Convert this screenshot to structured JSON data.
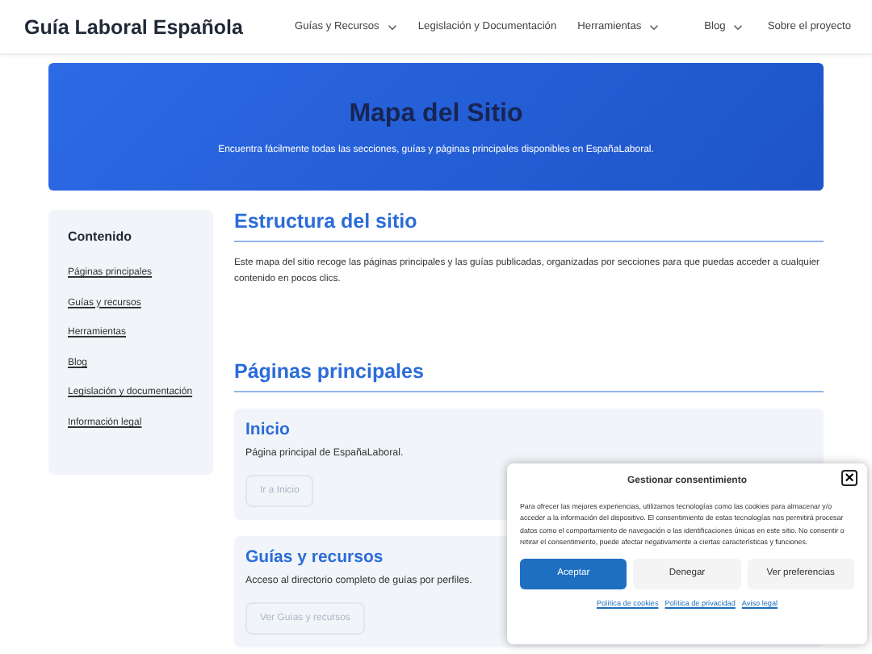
{
  "header": {
    "logo": "Guía Laboral Española",
    "nav": [
      {
        "label": "Guías y Recursos",
        "dropdown": true
      },
      {
        "label": "Legislación y Documentación",
        "dropdown": false
      },
      {
        "label": "Herramientas",
        "dropdown": true
      },
      {
        "label": "Blog",
        "dropdown": true
      },
      {
        "label": "Sobre el proyecto",
        "dropdown": false
      }
    ]
  },
  "hero": {
    "title": "Mapa del Sitio",
    "subtitle": "Encuentra fácilmente todas las secciones, guías y páginas principales disponibles en EspañaLaboral."
  },
  "sidebar": {
    "title": "Contenido",
    "links": [
      "Páginas principales",
      "Guías y recursos",
      "Herramientas",
      "Blog",
      "Legislación y documentación",
      "Información legal"
    ]
  },
  "main": {
    "sections": [
      {
        "heading": "Estructura del sitio",
        "intro": "Este mapa del sitio recoge las páginas principales y las guías publicadas, organizadas por secciones para que puedas acceder a cualquier contenido en pocos clics."
      },
      {
        "heading": "Páginas principales",
        "cards": [
          {
            "title": "Inicio",
            "description": "Página principal de EspañaLaboral.",
            "button": "Ir a Inicio"
          },
          {
            "title": "Guías y recursos",
            "description": "Acceso al directorio completo de guías por perfiles.",
            "button": "Ver Guías y recursos"
          }
        ]
      }
    ]
  },
  "consent": {
    "title": "Gestionar consentimiento",
    "close": "×",
    "text": "Para ofrecer las mejores experiencias, utilizamos tecnologías como las cookies para almacenar y/o acceder a la información del dispositivo. El consentimiento de estas tecnologías nos permitirá procesar datos como el comportamiento de navegación o las identificaciones únicas en este sitio. No consentir o retirar el consentimiento, puede afectar negativamente a ciertas características y funciones.",
    "buttons": [
      {
        "label": "Aceptar",
        "primary": true
      },
      {
        "label": "Denegar",
        "primary": false
      },
      {
        "label": "Ver preferencias",
        "primary": false
      }
    ],
    "links": [
      "Política de cookies",
      "Política de privacidad",
      "Aviso legal"
    ]
  }
}
